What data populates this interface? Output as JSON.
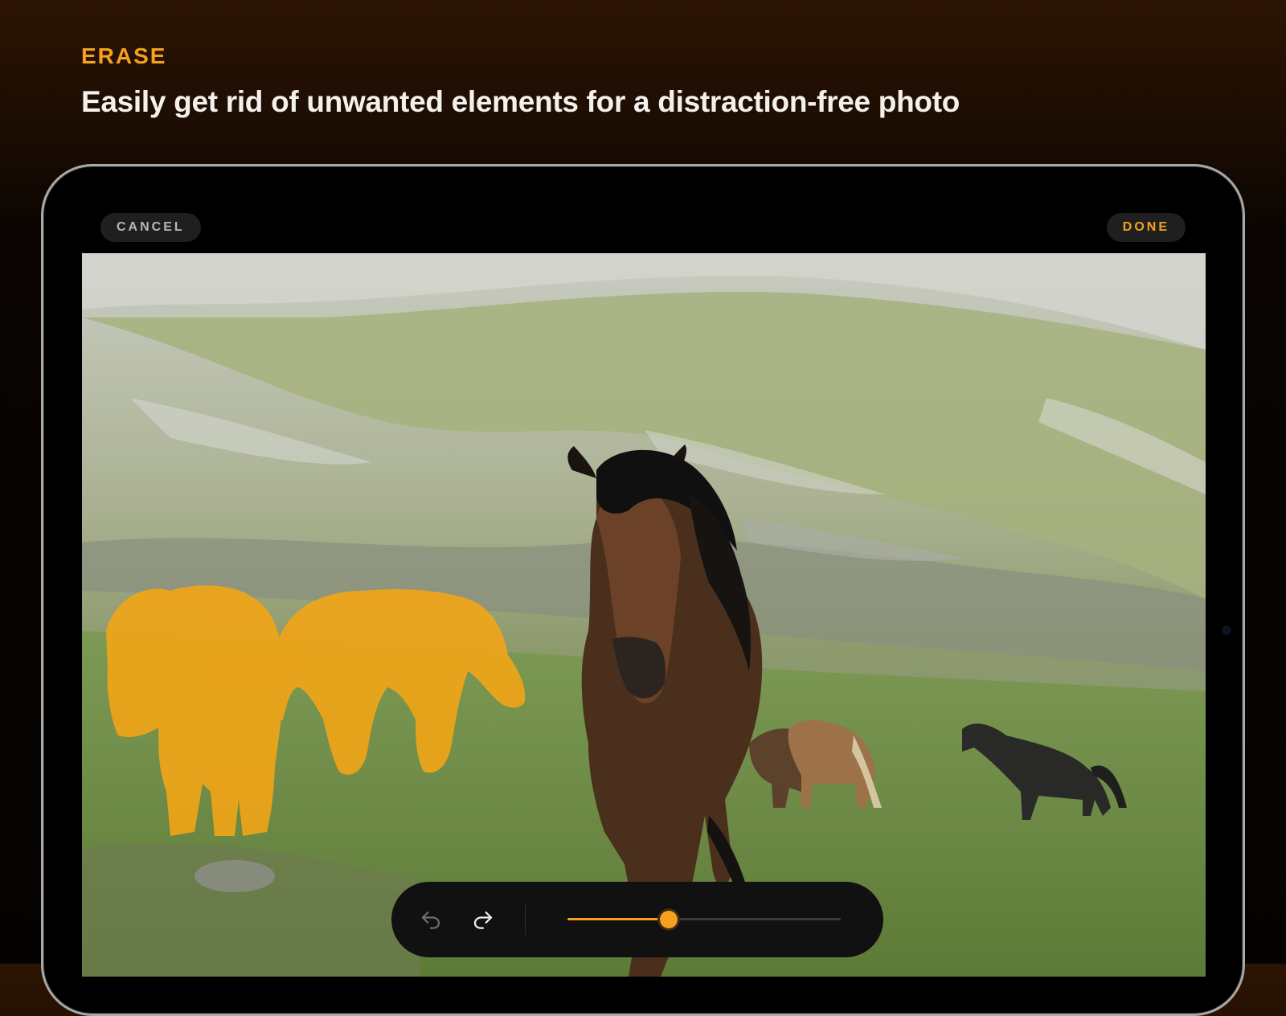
{
  "header": {
    "eyebrow": "ERASE",
    "headline": "Easily get rid of unwanted elements for a distraction-free photo"
  },
  "top_bar": {
    "cancel_label": "CANCEL",
    "done_label": "DONE"
  },
  "toolbar": {
    "undo_icon": "undo-icon",
    "redo_icon": "redo-icon",
    "brush_size_fraction": 0.37
  },
  "colors": {
    "accent": "#f5a11f",
    "mask": "#f2a516"
  }
}
